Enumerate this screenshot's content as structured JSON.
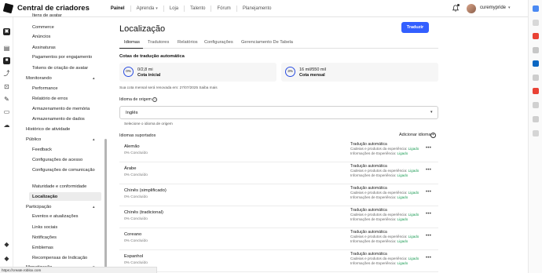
{
  "app": {
    "brand": "Central de criadores"
  },
  "topnav": {
    "items": [
      {
        "label": "Painel"
      },
      {
        "label": "Aprenda"
      },
      {
        "label": "Loja"
      },
      {
        "label": "Talento"
      },
      {
        "label": "Fórum"
      },
      {
        "label": "Planejamento"
      }
    ],
    "user": "curemypride"
  },
  "sidebar": {
    "items": [
      {
        "label": "Itens de avatar",
        "kind": "item"
      },
      {
        "label": "Commerce",
        "kind": "item"
      },
      {
        "label": "Anúncios",
        "kind": "item"
      },
      {
        "label": "Assinaturas",
        "kind": "item"
      },
      {
        "label": "Pagamentos por engajamento",
        "kind": "item"
      },
      {
        "label": "Tokens de criação de avatar",
        "kind": "item"
      },
      {
        "label": "Monitorando",
        "kind": "section"
      },
      {
        "label": "Performance",
        "kind": "item"
      },
      {
        "label": "Relatório de erros",
        "kind": "item"
      },
      {
        "label": "Armazenamento de memória",
        "kind": "item"
      },
      {
        "label": "Armazenamento de dados",
        "kind": "item"
      },
      {
        "label": "Histórico de atividade",
        "kind": "section"
      },
      {
        "label": "Público",
        "kind": "section"
      },
      {
        "label": "Feedback",
        "kind": "item"
      },
      {
        "label": "Configurações de acesso",
        "kind": "item"
      },
      {
        "label": "Configurações de comunicação",
        "kind": "item"
      },
      {
        "label": "Maturidade e conformidade",
        "kind": "item"
      },
      {
        "label": "Localização",
        "kind": "item"
      },
      {
        "label": "Participação",
        "kind": "section"
      },
      {
        "label": "Eventos e atualizações",
        "kind": "item"
      },
      {
        "label": "Links sociais",
        "kind": "item"
      },
      {
        "label": "Notificações",
        "kind": "item"
      },
      {
        "label": "Emblemas",
        "kind": "item"
      },
      {
        "label": "Recompensas de Indicação",
        "kind": "item"
      },
      {
        "label": "Monetização",
        "kind": "section"
      }
    ]
  },
  "page": {
    "title": "Localização",
    "translate_button": "Traduzir",
    "tabs": [
      {
        "label": "Idiomas"
      },
      {
        "label": "Tradutores"
      },
      {
        "label": "Relatórios"
      },
      {
        "label": "Configurações"
      },
      {
        "label": "Gerenciamento De Tabela"
      }
    ],
    "quota_title": "Cotas de tradução automática",
    "quotas": [
      {
        "percent": "0%",
        "value": "0/2,8 mi",
        "label": "Cota inicial"
      },
      {
        "percent": "3%",
        "value": "16 mil/550 mil",
        "label": "Cota mensal"
      }
    ],
    "renew_text": "Sua cota mensal será renovada em: 27/07/2025",
    "renew_link": "Saiba mais",
    "origin_label": "Idioma de origem",
    "origin_value": "Inglês",
    "origin_help": "Selecione o idioma de origem",
    "supported_label": "Idiomas suportados",
    "add_language": "Adicionar idioma",
    "languages": [
      {
        "name": "Alemão",
        "progress": "0% Concluído"
      },
      {
        "name": "Árabe",
        "progress": "0% Concluído"
      },
      {
        "name": "Chinês (simplificado)",
        "progress": "0% Concluído"
      },
      {
        "name": "Chinês (tradicional)",
        "progress": "0% Concluído"
      },
      {
        "name": "Coreano",
        "progress": "0% Concluído"
      },
      {
        "name": "Espanhol",
        "progress": "0% Concluído"
      }
    ],
    "auto_translation": {
      "title": "Tradução automática",
      "line1": "Cadeias e produtos da experiência:",
      "line2": "Informações de Experiência:",
      "status": "Ligado"
    }
  },
  "status_url": "https://create.roblox.com"
}
